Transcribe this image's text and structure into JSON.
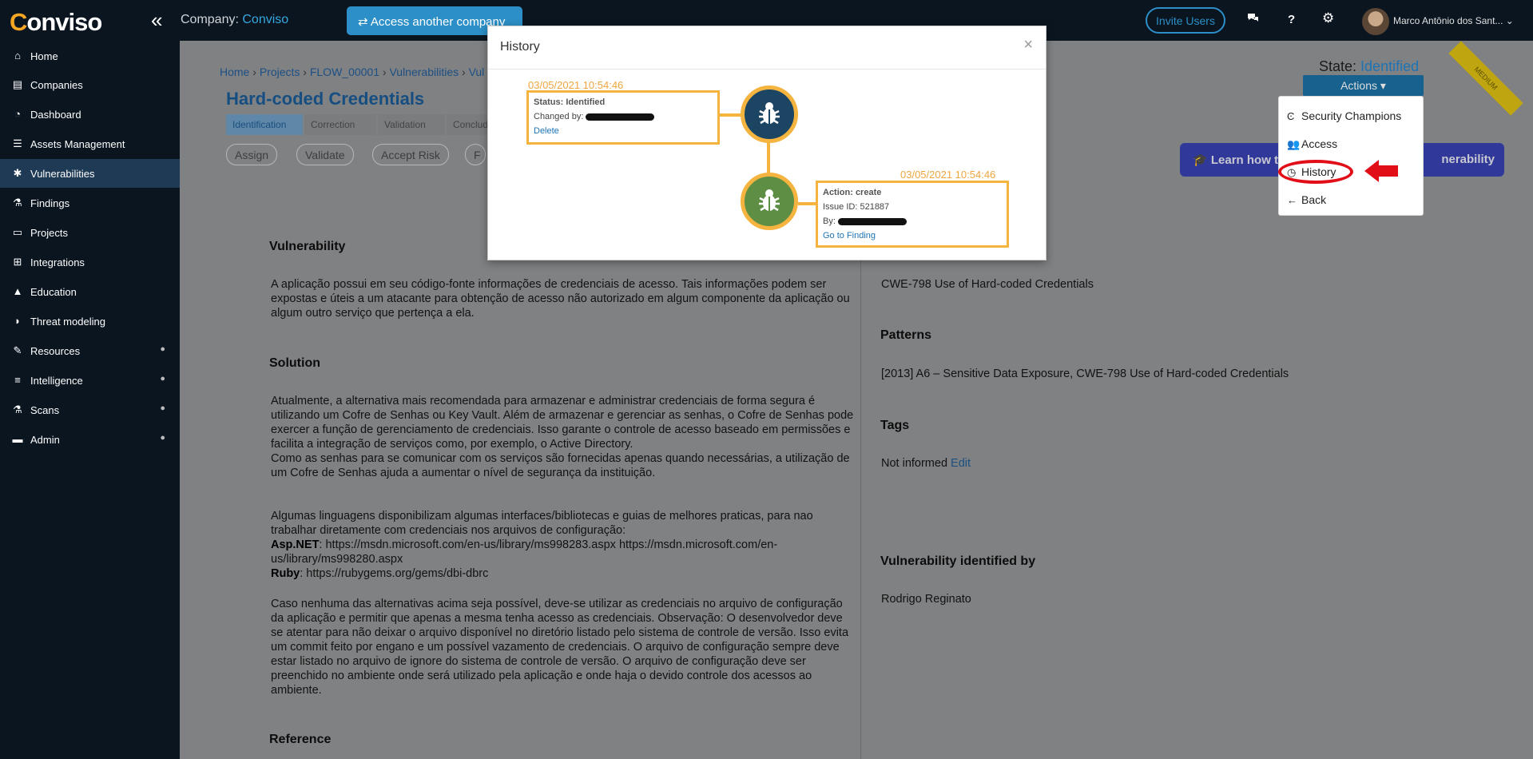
{
  "topbar": {
    "logo_prefix": "C",
    "logo_rest": "onviso",
    "company_label": "Company:",
    "company_value": "Conviso",
    "access_button": "Access another company",
    "invite_button": "Invite Users",
    "user_name": "Marco Antônio dos Sant..."
  },
  "sidebar": {
    "items": [
      {
        "label": "Home",
        "icon": "home-icon"
      },
      {
        "label": "Companies",
        "icon": "building-icon"
      },
      {
        "label": "Dashboard",
        "icon": "dashboard-icon"
      },
      {
        "label": "Assets Management",
        "icon": "server-icon"
      },
      {
        "label": "Vulnerabilities",
        "icon": "bug-icon"
      },
      {
        "label": "Findings",
        "icon": "flask-icon"
      },
      {
        "label": "Projects",
        "icon": "folder-icon"
      },
      {
        "label": "Integrations",
        "icon": "sitemap-icon"
      },
      {
        "label": "Education",
        "icon": "graduation-cap-icon"
      },
      {
        "label": "Threat modeling",
        "icon": "shield-icon"
      },
      {
        "label": "Resources",
        "icon": "wrench-icon"
      },
      {
        "label": "Intelligence",
        "icon": "database-icon"
      },
      {
        "label": "Scans",
        "icon": "flask-icon"
      },
      {
        "label": "Admin",
        "icon": "briefcase-icon"
      }
    ]
  },
  "breadcrumb": {
    "items": [
      "Home",
      "Projects",
      "FLOW_00001",
      "Vulnerabilities",
      "Vul"
    ]
  },
  "page_title": "Hard-coded Credentials",
  "steps": [
    "Identification",
    "Correction",
    "Validation",
    "Conclude"
  ],
  "action_buttons": [
    "Assign",
    "Validate",
    "Accept Risk",
    "F"
  ],
  "state": {
    "label": "State:",
    "value": "Identified"
  },
  "actions_button": "Actions",
  "ribbon": "MEDIUM",
  "learn_button": {
    "left": "Learn how t",
    "right": "nerability"
  },
  "content": {
    "vulnerability_heading": "Vulnerability",
    "vulnerability_text": "A aplicação possui em seu código-fonte informações de credenciais de acesso. Tais informações podem ser expostas e úteis a um atacante para obtenção de acesso não autorizado em algum componente da aplicação ou algum outro serviço que pertença a ela.",
    "solution_heading": "Solution",
    "solution_p1": "Atualmente, a alternativa mais recomendada para armazenar e administrar credenciais de forma segura é utilizando um Cofre de Senhas ou Key Vault. Além de armazenar e gerenciar as senhas, o Cofre de Senhas pode exercer a função de gerenciamento de credenciais. Isso garante o controle de acesso baseado em permissões e facilita a integração de serviços como, por exemplo, o Active Directory.",
    "solution_p2": "Como as senhas para se comunicar com os serviços são fornecidas apenas quando necessárias, a utilização de um Cofre de Senhas ajuda a aumentar o nível de segurança da instituição.",
    "solution_p3": "Algumas linguagens disponibilizam algumas interfaces/bibliotecas e guias de melhores praticas, para nao trabalhar diretamente com credenciais nos arquivos de configuração:",
    "aspnet_label": "Asp.NET",
    "aspnet_links": ": https://msdn.microsoft.com/en-us/library/ms998283.aspx https://msdn.microsoft.com/en-us/library/ms998280.aspx",
    "ruby_label": "Ruby",
    "ruby_link": ": https://rubygems.org/gems/dbi-dbrc",
    "solution_p4": "Caso nenhuma das alternativas acima seja possível, deve-se utilizar as credenciais no arquivo de configuração da aplicação e permitir que apenas a mesma tenha acesso as credenciais. Observação: O desenvolvedor deve se atentar para não deixar o arquivo disponível no diretório listado pelo sistema de controle de versão. Isso evita um commit feito por engano e um possível vazamento de credenciais. O arquivo de configuração sempre deve estar listado no arquivo de ignore do sistema de controle de versão. O arquivo de configuração deve ser preenchido no ambiente onde será utilizado pela aplicação e onde haja o devido controle dos acessos ao ambiente.",
    "reference_heading": "Reference",
    "cwe_text": "CWE-798 Use of Hard-coded Credentials",
    "patterns_heading": "Patterns",
    "patterns_text": "[2013] A6 – Sensitive Data Exposure, CWE-798 Use of Hard-coded Credentials",
    "tags_heading": "Tags",
    "tags_text": "Not informed",
    "tags_edit": "Edit",
    "identified_by_heading": "Vulnerability identified by",
    "identified_by_text": "Rodrigo Reginato"
  },
  "dropdown": {
    "items": [
      {
        "label": "Security Champions",
        "icon": "champion-icon"
      },
      {
        "label": "Access",
        "icon": "users-icon"
      },
      {
        "label": "History",
        "icon": "clock-icon"
      },
      {
        "label": "Back",
        "icon": "arrow-left-icon"
      }
    ]
  },
  "modal": {
    "title": "History",
    "close": "×",
    "events": [
      {
        "timestamp": "03/05/2021 10:54:46",
        "title": "Status: Identified",
        "line2_label": "Changed by:",
        "link": "Delete"
      },
      {
        "timestamp": "03/05/2021 10:54:46",
        "title": "Action: create",
        "line2": "Issue ID: 521887",
        "line3_label": "By:",
        "link": "Go to Finding"
      }
    ]
  },
  "colors": {
    "accent": "#1e73b5",
    "sidebar_bg": "#0a1520",
    "timeline_orange": "#f4b43f",
    "highlight_red": "#e10d17"
  }
}
